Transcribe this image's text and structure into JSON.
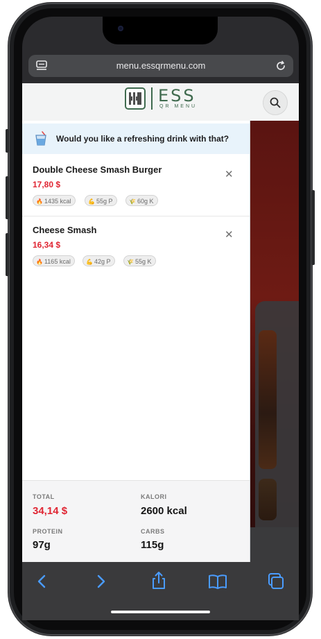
{
  "browser": {
    "url": "menu.essqrmenu.com"
  },
  "header": {
    "logo_text": "ESS",
    "logo_sub": "QR MENU"
  },
  "banner": {
    "text": "Would you like a refreshing drink with that?",
    "icon": "drink-icon"
  },
  "cart": {
    "items": [
      {
        "name": "Double Cheese Smash Burger",
        "price": "17,80 $",
        "kcal": "1435 kcal",
        "protein": "55g P",
        "carbs": "60g K"
      },
      {
        "name": "Cheese Smash",
        "price": "16,34 $",
        "kcal": "1165 kcal",
        "protein": "42g P",
        "carbs": "55g K"
      }
    ]
  },
  "summary": {
    "total_label": "TOTAL",
    "total_value": "34,14 $",
    "kalori_label": "KALORI",
    "kalori_value": "2600 kcal",
    "protein_label": "PROTEIN",
    "protein_value": "97g",
    "carbs_label": "CARBS",
    "carbs_value": "115g"
  },
  "colors": {
    "accent_price": "#e02633",
    "brand_green": "#3f6a4e",
    "banner_bg": "#e8f3fb",
    "toolbar_icon": "#4a9cff"
  },
  "toolbar": {
    "icons": [
      "back-icon",
      "forward-icon",
      "share-icon",
      "bookmarks-icon",
      "tabs-icon"
    ]
  }
}
